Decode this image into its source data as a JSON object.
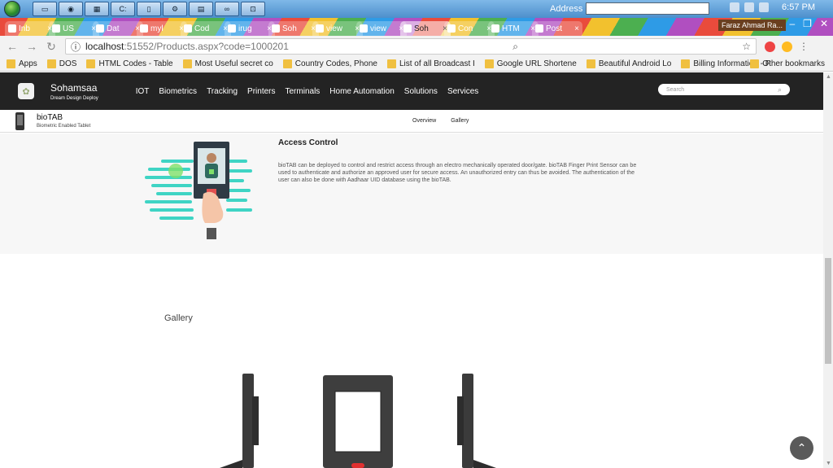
{
  "taskbar": {
    "address_label": "Address",
    "clock": "6:57 PM"
  },
  "browser": {
    "tabs": [
      {
        "label": "Inb",
        "icon": "gmail-icon"
      },
      {
        "label": "US",
        "icon": "drive-icon"
      },
      {
        "label": "Dat",
        "icon": "code-icon"
      },
      {
        "label": "myl",
        "icon": "page-icon"
      },
      {
        "label": "Cod",
        "icon": "code-icon"
      },
      {
        "label": "irug",
        "icon": "search-icon"
      },
      {
        "label": "Soh",
        "icon": "site-icon"
      },
      {
        "label": "view",
        "icon": "site-icon"
      },
      {
        "label": "view",
        "icon": "site-icon"
      },
      {
        "label": "Soh",
        "icon": "site-icon",
        "active": true
      },
      {
        "label": "Con",
        "icon": "windows-icon"
      },
      {
        "label": "HTM",
        "icon": "html-icon"
      },
      {
        "label": "Post",
        "icon": "post-icon"
      }
    ],
    "profile_name": "Faraz Ahmad Ra...",
    "url_host": "localhost",
    "url_rest": ":51552/Products.aspx?code=1000201",
    "bookmarks": [
      {
        "label": "Apps",
        "icon": "apps-grid-icon"
      },
      {
        "label": "DOS",
        "icon": "folder-icon"
      },
      {
        "label": "HTML Codes - Table",
        "icon": "page-icon"
      },
      {
        "label": "Most Useful secret co",
        "icon": "page-icon"
      },
      {
        "label": "Country Codes, Phone",
        "icon": "cc-icon"
      },
      {
        "label": "List of all Broadcast I",
        "icon": "github-icon"
      },
      {
        "label": "Google URL Shortene",
        "icon": "google-icon"
      },
      {
        "label": "Beautiful Android Lo",
        "icon": "page-icon"
      },
      {
        "label": "Billing Information - F",
        "icon": "page-icon"
      }
    ],
    "other_bookmarks": "Other bookmarks"
  },
  "site": {
    "brand_name": "Sohamsaa",
    "brand_tagline": "Dream Design Deploy",
    "menu": [
      "IOT",
      "Biometrics",
      "Tracking",
      "Printers",
      "Terminals",
      "Home Automation",
      "Solutions",
      "Services"
    ],
    "search_placeholder": "Search"
  },
  "product": {
    "name": "bioTAB",
    "subtitle": "Biometric Enabled Tablet",
    "tabs": [
      "Overview",
      "Gallery"
    ]
  },
  "feature": {
    "title": "Access Control",
    "body": "bioTAB can be deployed to control and restrict access through an electro mechanically operated door/gate. bioTAB Finger Print Sensor can be used to authenticate and authorize an approved user for secure access. An unauthorized entry can thus be avoided. The authentication of the user can also be done with Aadhaar UID database using the bioTAB."
  },
  "gallery": {
    "title": "Gallery"
  },
  "colors": {
    "nav_bg": "#232323",
    "illustration_teal": "#3fd4c4",
    "feature_bg": "#f7f7f7"
  }
}
